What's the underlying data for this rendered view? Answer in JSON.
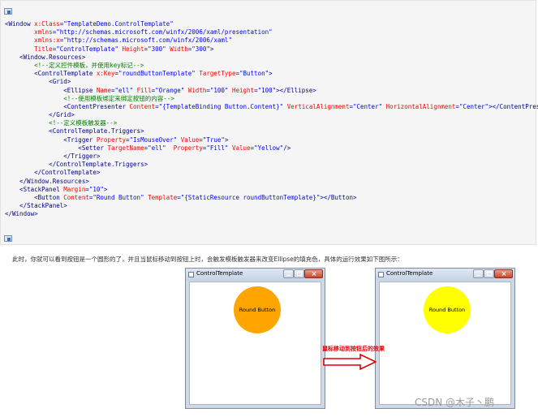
{
  "code_block": {
    "lines": [
      [
        {
          "t": "tg",
          "s": "<Window "
        },
        {
          "t": "at",
          "s": "x:Class"
        },
        {
          "t": "tg",
          "s": "="
        },
        {
          "t": "vl",
          "s": "\"TemplateDemo.ControlTemplate\""
        }
      ],
      [
        {
          "t": "tg",
          "s": "        "
        },
        {
          "t": "at",
          "s": "xmlns"
        },
        {
          "t": "tg",
          "s": "="
        },
        {
          "t": "vl",
          "s": "\"http://schemas.microsoft.com/winfx/2006/xaml/presentation\""
        }
      ],
      [
        {
          "t": "tg",
          "s": "        "
        },
        {
          "t": "at",
          "s": "xmlns:x"
        },
        {
          "t": "tg",
          "s": "="
        },
        {
          "t": "vl",
          "s": "\"http://schemas.microsoft.com/winfx/2006/xaml\""
        }
      ],
      [
        {
          "t": "tg",
          "s": "        "
        },
        {
          "t": "at",
          "s": "Title"
        },
        {
          "t": "tg",
          "s": "="
        },
        {
          "t": "vl",
          "s": "\"ControlTemplate\" "
        },
        {
          "t": "at",
          "s": "Height"
        },
        {
          "t": "tg",
          "s": "="
        },
        {
          "t": "vl",
          "s": "\"300\" "
        },
        {
          "t": "at",
          "s": "Width"
        },
        {
          "t": "tg",
          "s": "="
        },
        {
          "t": "vl",
          "s": "\"300\""
        },
        {
          "t": "tg",
          "s": ">"
        }
      ],
      [
        {
          "t": "tg",
          "s": "    <Window.Resources>"
        }
      ],
      [
        {
          "t": "cm",
          "s": "        <!--定义控件模板，并使用key标记-->"
        }
      ],
      [
        {
          "t": "tg",
          "s": "        <ControlTemplate "
        },
        {
          "t": "at",
          "s": "x:Key"
        },
        {
          "t": "tg",
          "s": "="
        },
        {
          "t": "vl",
          "s": "\"roundButtonTemplate\" "
        },
        {
          "t": "at",
          "s": "TargetType"
        },
        {
          "t": "tg",
          "s": "="
        },
        {
          "t": "vl",
          "s": "\"Button\""
        },
        {
          "t": "tg",
          "s": ">"
        }
      ],
      [
        {
          "t": "tg",
          "s": "            <Grid>"
        }
      ],
      [
        {
          "t": "tg",
          "s": "                <Ellipse "
        },
        {
          "t": "at",
          "s": "Name"
        },
        {
          "t": "tg",
          "s": "="
        },
        {
          "t": "vl",
          "s": "\"ell\" "
        },
        {
          "t": "at",
          "s": "Fill"
        },
        {
          "t": "tg",
          "s": "="
        },
        {
          "t": "vl",
          "s": "\"Orange\" "
        },
        {
          "t": "at",
          "s": "Width"
        },
        {
          "t": "tg",
          "s": "="
        },
        {
          "t": "vl",
          "s": "\"100\" "
        },
        {
          "t": "at",
          "s": "Height"
        },
        {
          "t": "tg",
          "s": "="
        },
        {
          "t": "vl",
          "s": "\"100\""
        },
        {
          "t": "tg",
          "s": "></Ellipse>"
        }
      ],
      [
        {
          "t": "cm",
          "s": "                <!--使用模板绑定来绑定按钮的内容-->"
        }
      ],
      [
        {
          "t": "tg",
          "s": "                <ContentPresenter "
        },
        {
          "t": "at",
          "s": "Content"
        },
        {
          "t": "tg",
          "s": "="
        },
        {
          "t": "vl",
          "s": "\"{TemplateBinding Button.Content}\" "
        },
        {
          "t": "at",
          "s": "VerticalAlignment"
        },
        {
          "t": "tg",
          "s": "="
        },
        {
          "t": "vl",
          "s": "\"Center\" "
        },
        {
          "t": "at",
          "s": "HorizontalAlignment"
        },
        {
          "t": "tg",
          "s": "="
        },
        {
          "t": "vl",
          "s": "\"Center\""
        },
        {
          "t": "tg",
          "s": "></ContentPresenter>"
        }
      ],
      [
        {
          "t": "tg",
          "s": "            </Grid>"
        }
      ],
      [
        {
          "t": "cm",
          "s": "            <!--定义模板触发器-->"
        }
      ],
      [
        {
          "t": "tg",
          "s": "            <ControlTemplate.Triggers>"
        }
      ],
      [
        {
          "t": "tg",
          "s": "                <Trigger "
        },
        {
          "t": "at",
          "s": "Property"
        },
        {
          "t": "tg",
          "s": "="
        },
        {
          "t": "vl",
          "s": "\"IsMouseOver\" "
        },
        {
          "t": "at",
          "s": "Value"
        },
        {
          "t": "tg",
          "s": "="
        },
        {
          "t": "vl",
          "s": "\"True\""
        },
        {
          "t": "tg",
          "s": ">"
        }
      ],
      [
        {
          "t": "tg",
          "s": "                    <Setter "
        },
        {
          "t": "at",
          "s": "TargetName"
        },
        {
          "t": "tg",
          "s": "="
        },
        {
          "t": "vl",
          "s": "\"ell\"  "
        },
        {
          "t": "at",
          "s": "Property"
        },
        {
          "t": "tg",
          "s": "="
        },
        {
          "t": "vl",
          "s": "\"Fill\" "
        },
        {
          "t": "at",
          "s": "Value"
        },
        {
          "t": "tg",
          "s": "="
        },
        {
          "t": "vl",
          "s": "\"Yellow\""
        },
        {
          "t": "tg",
          "s": "/>"
        }
      ],
      [
        {
          "t": "tg",
          "s": "                </Trigger>"
        }
      ],
      [
        {
          "t": "tg",
          "s": "            </ControlTemplate.Triggers>"
        }
      ],
      [
        {
          "t": "tg",
          "s": "        </ControlTemplate>"
        }
      ],
      [
        {
          "t": "tg",
          "s": "    </Window.Resources>"
        }
      ],
      [
        {
          "t": "tg",
          "s": "    <StackPanel "
        },
        {
          "t": "at",
          "s": "Margin"
        },
        {
          "t": "tg",
          "s": "="
        },
        {
          "t": "vl",
          "s": "\"10\""
        },
        {
          "t": "tg",
          "s": ">"
        }
      ],
      [
        {
          "t": "tg",
          "s": "        <Button "
        },
        {
          "t": "at",
          "s": "Content"
        },
        {
          "t": "tg",
          "s": "="
        },
        {
          "t": "vl",
          "s": "\"Round Button\" "
        },
        {
          "t": "at",
          "s": "Template"
        },
        {
          "t": "tg",
          "s": "="
        },
        {
          "t": "vl",
          "s": "\"{StaticResource roundButtonTemplate}\""
        },
        {
          "t": "tg",
          "s": "></Button>"
        }
      ],
      [
        {
          "t": "tg",
          "s": "    </StackPanel>"
        }
      ],
      [
        {
          "t": "tg",
          "s": "</Window>"
        }
      ]
    ],
    "copy_icon": "copy-icon"
  },
  "description": "此时，你就可以看到按钮是一个圆形的了，并且当鼠标移动到按钮上时，会触发模板触发器来改变Ellipse的填充色，具体的运行效果如下图所示：",
  "windows": [
    {
      "title": "ControlTemplate",
      "button_label": "Round Button",
      "button_color": "#ffa500"
    },
    {
      "title": "ControlTemplate",
      "button_label": "Round Button",
      "button_color": "#ffff00"
    }
  ],
  "arrow": {
    "label": "鼠标移动到按钮后的效果",
    "color": "#e00000"
  },
  "watermark": "CSDN @木子丶鹏"
}
